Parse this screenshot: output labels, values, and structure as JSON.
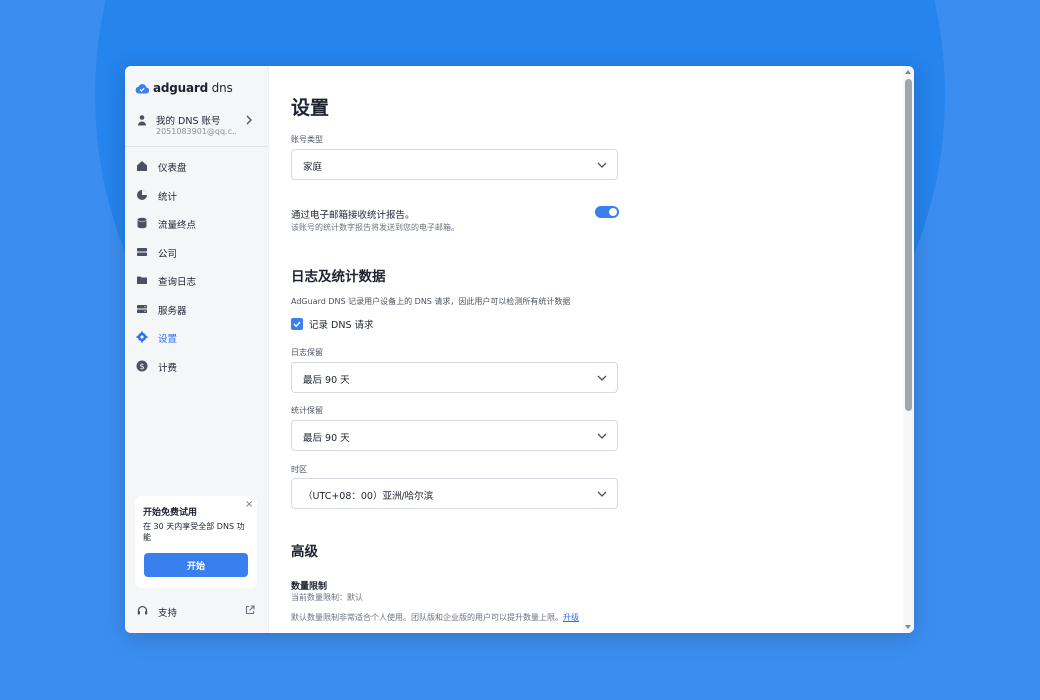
{
  "brand": {
    "name_bold": "adguard",
    "name_light": " dns",
    "accent": "#3a7ff0"
  },
  "account": {
    "name": "我的 DNS 账号",
    "email": "2051083901@qq.c..."
  },
  "nav": {
    "items": [
      {
        "label": "仪表盘",
        "icon": "home-icon"
      },
      {
        "label": "统计",
        "icon": "pie-chart-icon"
      },
      {
        "label": "流量终点",
        "icon": "database-icon"
      },
      {
        "label": "公司",
        "icon": "server-icon"
      },
      {
        "label": "查询日志",
        "icon": "folder-icon"
      },
      {
        "label": "服务器",
        "icon": "server-stack-icon"
      },
      {
        "label": "设置",
        "icon": "gear-icon",
        "active": true
      },
      {
        "label": "计费",
        "icon": "dollar-icon"
      }
    ]
  },
  "trial": {
    "title": "开始免费试用",
    "description": "在 30 天内享受全部 DNS 功能",
    "button": "开始",
    "close": "×"
  },
  "support": {
    "label": "支持"
  },
  "settings": {
    "title": "设置",
    "account_type": {
      "label": "账号类型",
      "value": "家庭"
    },
    "email_reports": {
      "title": "通过电子邮箱接收统计报告。",
      "description": "该账号的统计数字报告将发送到您的电子邮箱。",
      "enabled": true
    },
    "logs": {
      "title": "日志及统计数据",
      "description": "AdGuard DNS 记录用户设备上的 DNS 请求，因此用户可以检测所有统计数据",
      "log_checkbox": {
        "label": "记录 DNS 请求",
        "checked": true
      },
      "log_retention": {
        "label": "日志保留",
        "value": "最后 90 天"
      },
      "stats_retention": {
        "label": "统计保留",
        "value": "最后 90 天"
      },
      "timezone": {
        "label": "时区",
        "value": "（UTC+08：00）亚洲/哈尔滨"
      }
    },
    "advanced": {
      "title": "高级",
      "limit_title": "数量限制",
      "limit_current": "当前数量限制：默认",
      "limit_desc": "默认数量限制非常适合个人使用。团队版和企业版的用户可以提升数量上限。",
      "upgrade_link": "升级"
    }
  }
}
